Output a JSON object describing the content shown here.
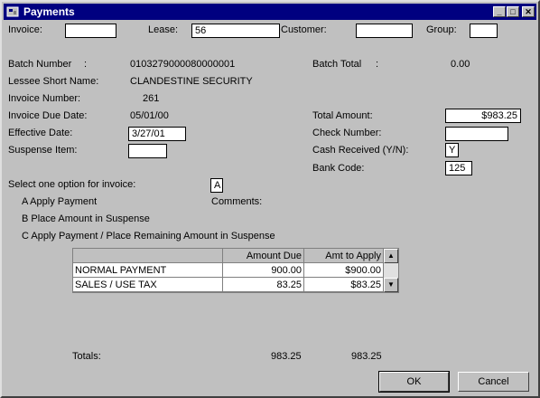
{
  "window": {
    "title": "Payments",
    "minimize": "_",
    "maximize": "□",
    "close": "✕"
  },
  "filters": {
    "invoice_label": "Invoice:",
    "invoice_value": "",
    "lease_label": "Lease:",
    "lease_value": "56",
    "customer_label": "Customer:",
    "customer_value": "",
    "group_label": "Group:",
    "group_value": ""
  },
  "details": {
    "batch_number_label": "Batch Number",
    "batch_number_colon": ":",
    "batch_number_value": "0103279000080000001",
    "batch_total_label": "Batch Total",
    "batch_total_colon": ":",
    "batch_total_value": "0.00",
    "lessee_label": "Lessee Short Name:",
    "lessee_value": "CLANDESTINE SECURITY",
    "invoice_number_label": "Invoice Number:",
    "invoice_number_value": "261",
    "due_date_label": "Invoice Due Date:",
    "due_date_value": "05/01/00",
    "total_amount_label": "Total Amount:",
    "total_amount_value": "$983.25",
    "effective_date_label": "Effective Date:",
    "effective_date_value": "3/27/01",
    "check_number_label": "Check Number:",
    "check_number_value": "",
    "suspense_label": "Suspense Item:",
    "suspense_value": "",
    "cash_received_label": "Cash Received (Y/N):",
    "cash_received_value": "Y",
    "bank_code_label": "Bank Code:",
    "bank_code_value": "125"
  },
  "options": {
    "prompt": "Select one option for invoice:",
    "selected": "A",
    "a": "A Apply Payment",
    "b": "B  Place Amount in Suspense",
    "c": "C  Apply Payment / Place Remaining Amount in Suspense",
    "comments_label": "Comments:"
  },
  "grid": {
    "columns": [
      "",
      "Amount Due",
      "Amt to Apply"
    ],
    "rows": [
      {
        "desc": "NORMAL PAYMENT",
        "amount_due": "900.00",
        "amt_to_apply": "$900.00"
      },
      {
        "desc": "SALES / USE TAX",
        "amount_due": "83.25",
        "amt_to_apply": "$83.25"
      }
    ]
  },
  "totals": {
    "label": "Totals:",
    "amount_due": "983.25",
    "amt_to_apply": "983.25"
  },
  "buttons": {
    "ok": "OK",
    "cancel": "Cancel"
  }
}
